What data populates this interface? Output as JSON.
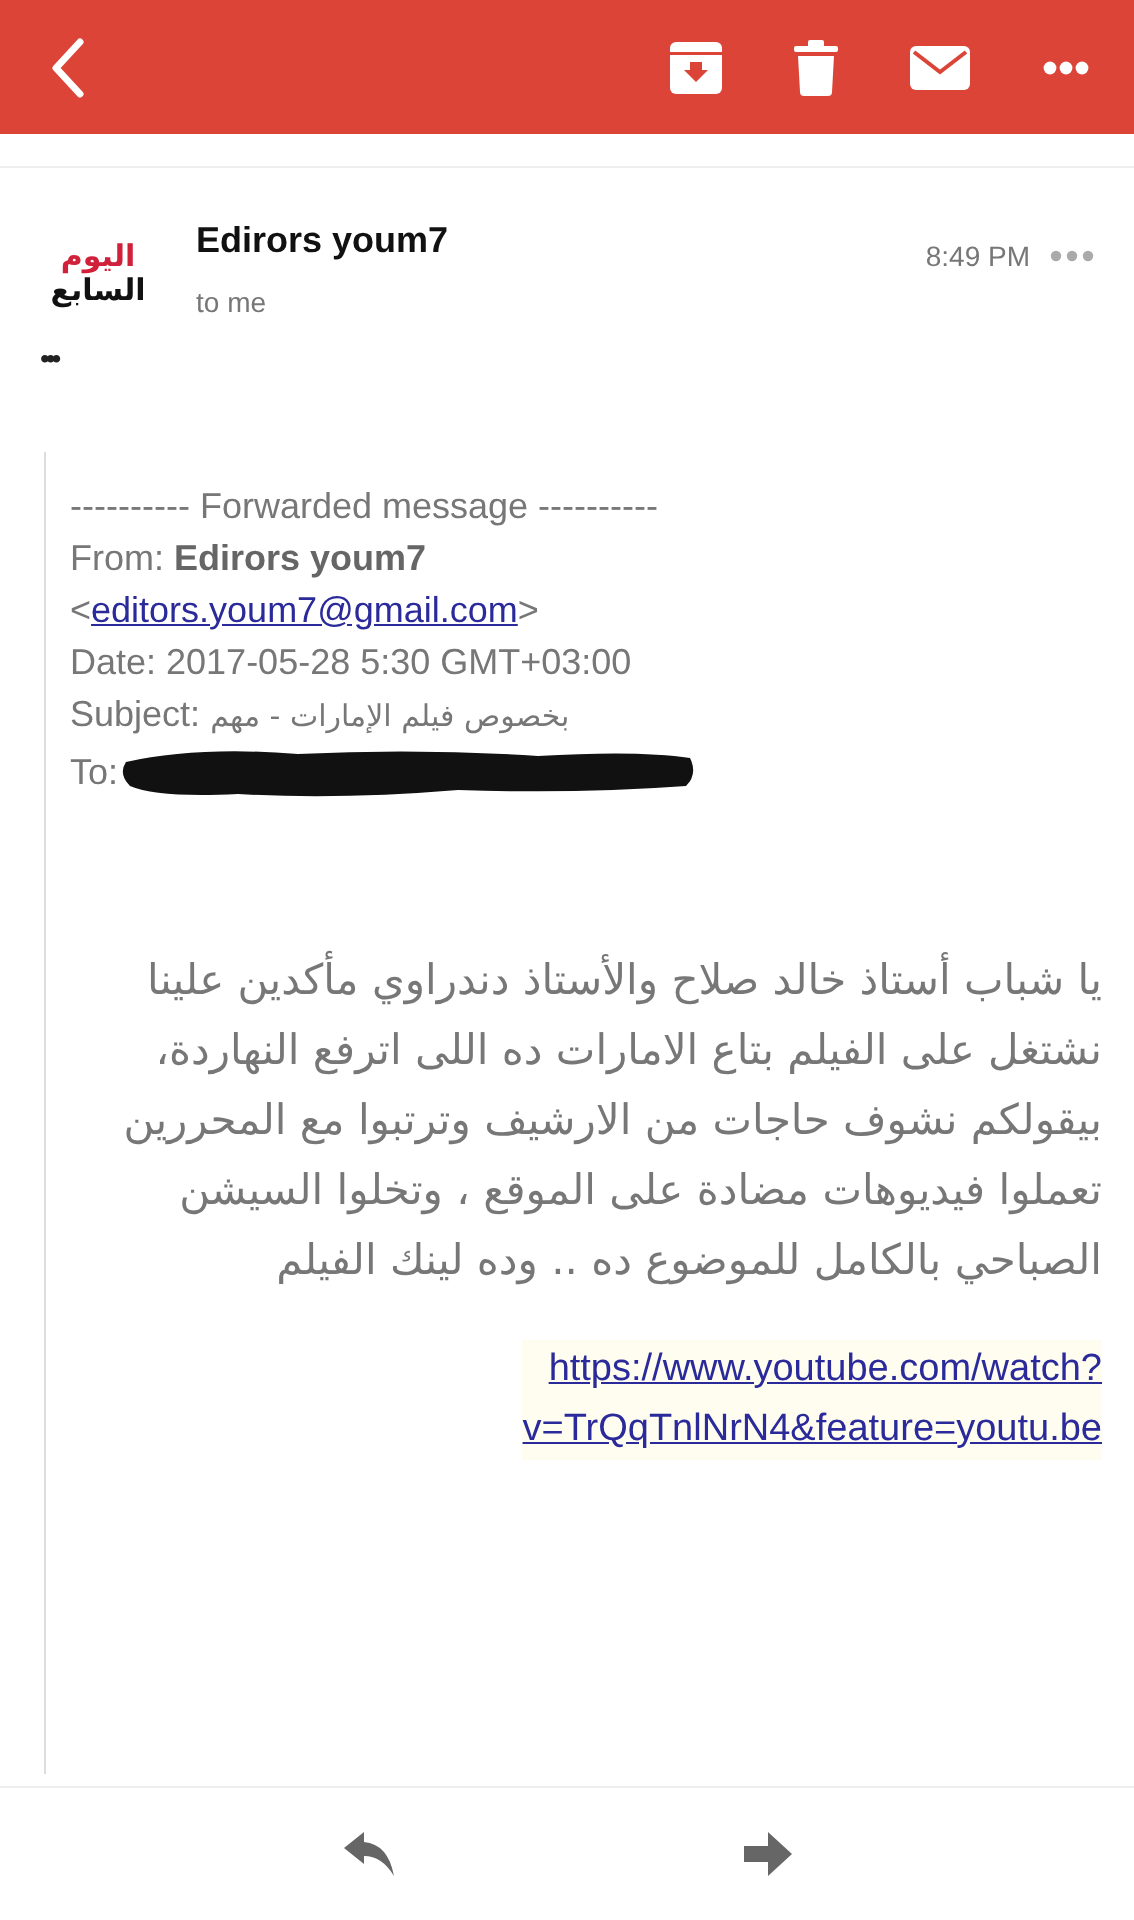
{
  "toolbar": {
    "actions": [
      {
        "kind": "archive"
      },
      {
        "kind": "delete"
      },
      {
        "kind": "mark-unread"
      },
      {
        "kind": "more"
      }
    ]
  },
  "message": {
    "avatar_lines": [
      "اليوم",
      "السابع"
    ],
    "sender": "Edirors youm7",
    "recipient": "to me",
    "time": "8:49 PM",
    "trimmed": "•••"
  },
  "forwarded": {
    "divider": "---------- Forwarded message ----------",
    "from_label": "From:",
    "from_name": "Edirors youm7",
    "email_open": "<",
    "from_email": "editors.youm7@gmail.com",
    "email_close": ">",
    "date": "Date: 2017-05-28 5:30 GMT+03:00",
    "subject_label": "Subject:",
    "subject": "بخصوص فيلم الإمارات - مهم",
    "to_label": "To:",
    "to_redacted": true,
    "body": "يا شباب أستاذ خالد صلاح والأستاذ دندراوي مأكدين علينا نشتغل على الفيلم بتاع الامارات ده اللى اترفع النهاردة، بيقولكم نشوف حاجات من الارشيف وترتبوا مع المحررين تعملوا فيديوهات مضادة على الموقع ، وتخلوا السيشن الصباحي بالكامل للموضوع ده .. وده لينك الفيلم",
    "link_lines": [
      "https://www.youtube.com/watch?",
      "v=TrQqTnlNrN4&feature=youtu.be"
    ]
  },
  "bottom_bar": {
    "actions": [
      {
        "kind": "reply"
      },
      {
        "kind": "forward"
      }
    ]
  }
}
